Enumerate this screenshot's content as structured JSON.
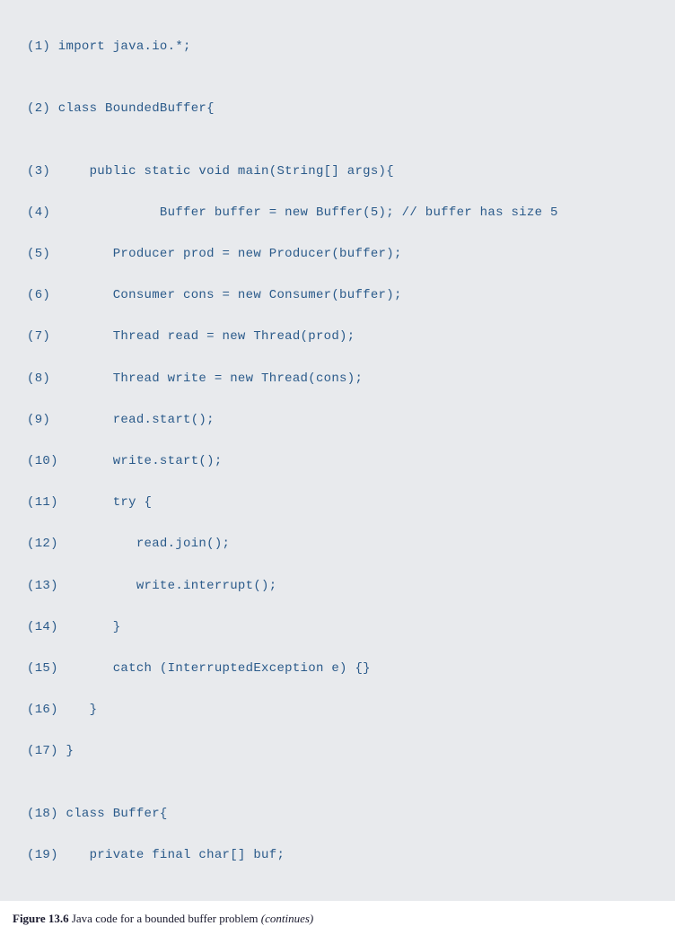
{
  "code": {
    "lines": [
      "(1) import java.io.*;",
      "",
      "(2) class BoundedBuffer{",
      "",
      "(3)     public static void main(String[] args){",
      "(4)              Buffer buffer = new Buffer(5); // buffer has size 5",
      "(5)        Producer prod = new Producer(buffer);",
      "(6)        Consumer cons = new Consumer(buffer);",
      "(7)        Thread read = new Thread(prod);",
      "(8)        Thread write = new Thread(cons);",
      "(9)        read.start();",
      "(10)       write.start();",
      "(11)       try {",
      "(12)          read.join();",
      "(13)          write.interrupt();",
      "(14)       }",
      "(15)       catch (InterruptedException e) {}",
      "(16)    }",
      "(17) }",
      "",
      "(18) class Buffer{",
      "(19)    private final char[] buf;"
    ]
  },
  "caption": {
    "label": "Figure 13.6",
    "text": " Java code for a bounded buffer problem ",
    "continues": "(continues)"
  }
}
